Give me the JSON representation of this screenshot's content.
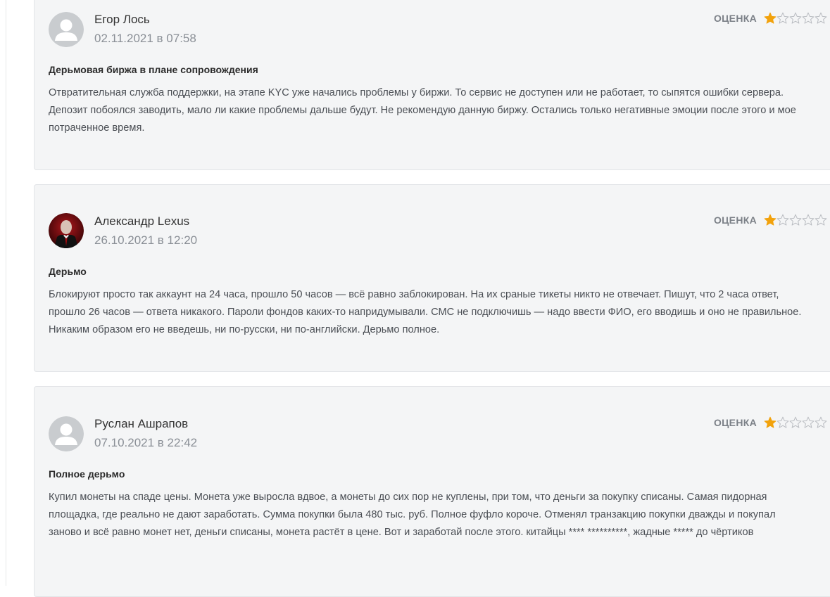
{
  "rating_label": "ОЦЕНКА",
  "reviews": [
    {
      "author": "Егор Лось",
      "date": "02.11.2021 в 07:58",
      "rating": 1,
      "max_rating": 5,
      "avatar": "default-avatar",
      "title": "Дерьмовая биржа в плане сопровождения",
      "body": "Отвратительная служба поддержки, на этапе KYC уже начались проблемы у биржи. То сервис не доступен или не работает, то сыпятся ошибки сервера. Депозит побоялся заводить, мало ли какие проблемы дальше будут. Не рекомендую данную биржу. Остались только негативные эмоции после этого и мое потраченное время."
    },
    {
      "author": "Александр Lexus",
      "date": "26.10.2021 в 12:20",
      "rating": 1,
      "max_rating": 5,
      "avatar": "photo-avatar",
      "title": "Дерьмо",
      "body": "Блокируют просто так аккаунт на 24 часа, прошло 50 часов — всё равно заблокирован. На их сраные тикеты никто не отвечает. Пишут, что 2 часа ответ, прошло 26 часов — ответа никакого. Пароли фондов каких-то напридумывали. СМС не подключишь — надо ввести ФИО, его вводишь и оно не правильное. Никаким образом его не введешь, ни по-русски, ни по-английски. Дерьмо полное."
    },
    {
      "author": "Руслан Ашрапов",
      "date": "07.10.2021 в 22:42",
      "rating": 1,
      "max_rating": 5,
      "avatar": "default-avatar",
      "title": "Полное дерьмо",
      "body": "Купил монеты на спаде цены. Монета уже выросла вдвое, а монеты до сих пор не куплены, при том, что деньги за покупку списаны. Самая пидорная площадка, где реально не дают заработать. Сумма покупки была 480 тыс. руб. Полное фуфло короче. Отменял транзакцию покупки дважды и покупал заново и всё равно монет нет, деньги списаны, монета растёт в цене. Вот и заработай после этого. китайцы **** **********, жадные ***** до чёртиков"
    }
  ],
  "colors": {
    "star_filled": "#f2a20c",
    "star_empty": "#b9bcc1",
    "card_bg": "#f4f5f6",
    "card_border": "#e2e4e7"
  }
}
